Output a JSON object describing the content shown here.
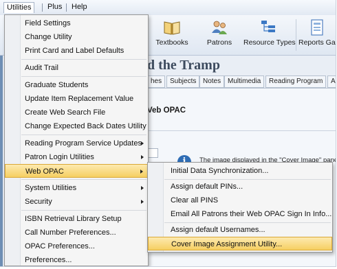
{
  "menubar": {
    "items": [
      {
        "label": "Utilities"
      },
      {
        "label": "Plus"
      },
      {
        "label": "Help"
      }
    ]
  },
  "ribbon": {
    "buttons": [
      {
        "label": "Textbooks",
        "icon": "book-icon"
      },
      {
        "label": "Patrons",
        "icon": "people-icon"
      },
      {
        "label": "Resource Types",
        "icon": "hierarchy-icon"
      },
      {
        "label": "Reports Gallery",
        "icon": "report-icon"
      }
    ]
  },
  "document": {
    "title": "d the Tramp",
    "tabs": [
      {
        "label": "hes"
      },
      {
        "label": "Subjects"
      },
      {
        "label": "Notes"
      },
      {
        "label": "Multimedia"
      },
      {
        "label": "Reading Program"
      },
      {
        "label": "A"
      }
    ],
    "section_title": "Veb OPAC",
    "info_text": "The image displayed in the \"Cover Image\" panel"
  },
  "utilities_menu": {
    "items": [
      {
        "label": "Field Settings",
        "has_submenu": false
      },
      {
        "label": "Change Utility",
        "has_submenu": false
      },
      {
        "label": "Print Card and Label Defaults",
        "has_submenu": false
      },
      {
        "label": "Audit Trail",
        "has_submenu": false
      },
      {
        "label": "Graduate Students",
        "has_submenu": false
      },
      {
        "label": "Update Item Replacement Value",
        "has_submenu": false
      },
      {
        "label": "Create Web Search File",
        "has_submenu": false
      },
      {
        "label": "Change Expected Back Dates Utility",
        "has_submenu": false
      },
      {
        "label": "Reading Program Service Updates",
        "has_submenu": true
      },
      {
        "label": "Patron Login Utilities",
        "has_submenu": true
      },
      {
        "label": "Web OPAC",
        "has_submenu": true,
        "highlighted": true
      },
      {
        "label": "System Utilities",
        "has_submenu": true
      },
      {
        "label": "Security",
        "has_submenu": true
      },
      {
        "label": "ISBN Retrieval Library Setup",
        "has_submenu": false
      },
      {
        "label": "Call Number Preferences...",
        "has_submenu": false
      },
      {
        "label": "OPAC Preferences...",
        "has_submenu": false
      },
      {
        "label": "Preferences...",
        "has_submenu": false
      }
    ]
  },
  "web_opac_submenu": {
    "items": [
      {
        "label": "Initial  Data Synchronization..."
      },
      {
        "label": "Assign default PINs..."
      },
      {
        "label": "Clear all PINS"
      },
      {
        "label": "Email All Patrons their Web OPAC Sign In Info..."
      },
      {
        "label": "Assign default Usernames..."
      },
      {
        "label": "Cover Image Assignment Utility...",
        "highlighted": true
      }
    ]
  },
  "colors": {
    "highlight": "#f6cf62",
    "info_icon": "#2f6db5"
  }
}
